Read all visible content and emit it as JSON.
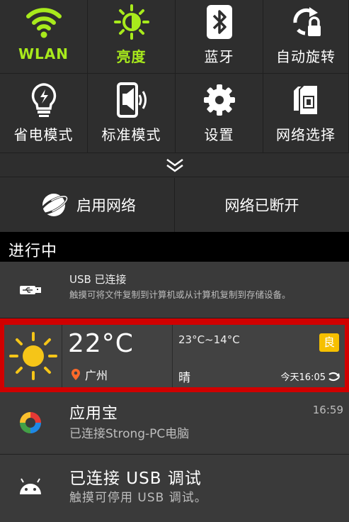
{
  "quick_settings": {
    "tiles": [
      {
        "label": "WLAN",
        "icon": "wifi-icon",
        "active": true
      },
      {
        "label": "亮度",
        "icon": "brightness-icon",
        "active": true
      },
      {
        "label": "蓝牙",
        "icon": "bluetooth-icon",
        "active": false
      },
      {
        "label": "自动旋转",
        "icon": "rotate-lock-icon",
        "active": false
      },
      {
        "label": "省电模式",
        "icon": "power-saving-icon",
        "active": false
      },
      {
        "label": "标准模式",
        "icon": "sound-mode-icon",
        "active": false
      },
      {
        "label": "设置",
        "icon": "gear-icon",
        "active": false
      },
      {
        "label": "网络选择",
        "icon": "sim-card-icon",
        "active": false
      }
    ],
    "enable_network_label": "启用网络",
    "network_status_label": "网络已断开",
    "accent_color": "#a8ea1c"
  },
  "section_title": "进行中",
  "notifications": {
    "usb": {
      "title": "USB 已连接",
      "desc": "触摸可将文件复制到计算机或从计算机复制到存储设备。"
    },
    "weather": {
      "temp": "22°C",
      "city": "广州",
      "range": "23°C~14°C",
      "condition": "晴",
      "aqi": "良",
      "updated": "今天16:05"
    },
    "app": {
      "title": "应用宝",
      "desc": "已连接Strong-PC电脑",
      "time": "16:59"
    },
    "debug": {
      "title": "已连接 USB 调试",
      "desc": "触摸可停用 USB 调试。"
    }
  }
}
